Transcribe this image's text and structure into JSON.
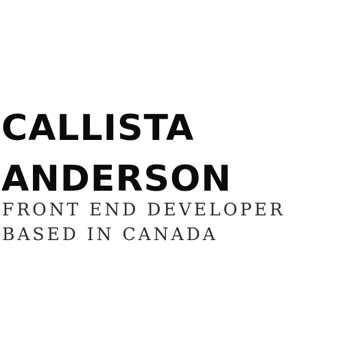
{
  "profile": {
    "name_line1": "CALLISTA",
    "name_line2": "ANDERSON",
    "title_line1": "FRONT END DEVELOPER",
    "title_line2": "BASED IN CANADA"
  },
  "colors": {
    "background": "#ffffff",
    "name_text": "#0b0b0b",
    "title_text": "#2b2b2b"
  }
}
